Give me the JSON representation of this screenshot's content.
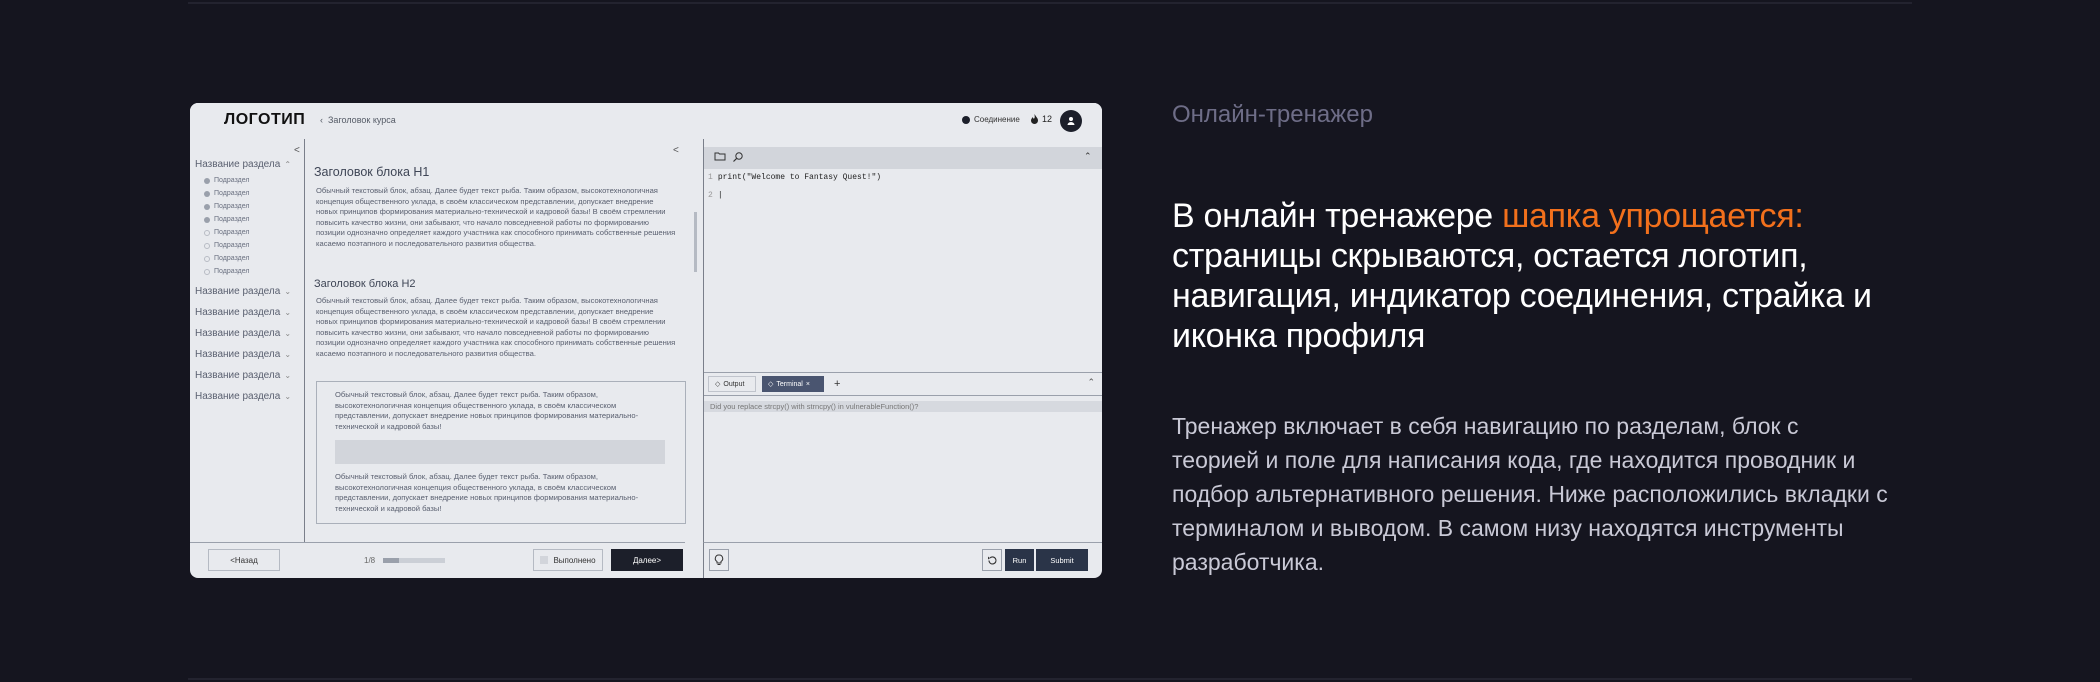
{
  "mockup": {
    "logo": "ЛОГОТИП",
    "breadcrumb": "Заголовок курса",
    "connection": "Соединение",
    "streak": "12",
    "sidebar": {
      "section_title": "Название раздела",
      "subsections": [
        "Подраздел",
        "Подраздел",
        "Подраздел",
        "Подраздел",
        "Подраздел",
        "Подраздел",
        "Подраздел",
        "Подраздел"
      ],
      "sections": [
        "Название раздела",
        "Название раздела",
        "Название раздела",
        "Название раздела",
        "Название раздела",
        "Название раздела"
      ]
    },
    "content": {
      "h1": "Заголовок блока H1",
      "h2": "Заголовок блока H2",
      "para_long": "Обычный текстовый блок, абзац. Далее будет текст рыба. Таким образом, высокотехнологичная концепция общественного уклада, в своём классическом представлении, допускает внедрение новых принципов формирования материально-технической и кадровой базы! В своём стремлении повысить качество жизни, они забывают, что начало повседневной работы по формированию позиции однозначно определяет каждого участника как способного принимать собственные решения касаемо поэтапного и последовательного развития общества.",
      "para_short": "Обычный текстовый блок, абзац. Далее будет текст рыба. Таким образом, высокотехнологичная концепция общественного уклада, в своём классическом представлении, допускает внедрение новых принципов формирования материально-технической и кадровой базы!"
    },
    "footer": {
      "back": "<Назад",
      "pager": "1/8",
      "progress": 0.25,
      "done": "Выполнено",
      "next": "Далее>"
    },
    "editor": {
      "line1_no": "1",
      "line1": "print(\"Welcome to Fantasy Quest!\")",
      "line2_no": "2",
      "tab_output": "Output",
      "tab_terminal": "Terminal",
      "terminal_text": "Did you replace strcpy() with strncpy() in vulnerableFunction()?",
      "run": "Run",
      "submit": "Submit"
    }
  },
  "text": {
    "eyebrow": "Онлайн-тренажер",
    "headline_pre": "В онлайн тренажере ",
    "headline_accent": "шапка упрощается:",
    "headline_post": " страницы скрываются, остается логотип, навигация, индикатор соединения, страйка и иконка профиля",
    "description": "Тренажер включает в себя навигацию по разделам, блок с теорией и поле для написания кода, где находится проводник и подбор альтернативного решения. Ниже расположились вкладки с терминалом и выводом. В самом низу находятся инструменты разработчика."
  },
  "colors": {
    "accent": "#f2701c",
    "background": "#15151f",
    "dark_button": "#1c1f2a"
  }
}
